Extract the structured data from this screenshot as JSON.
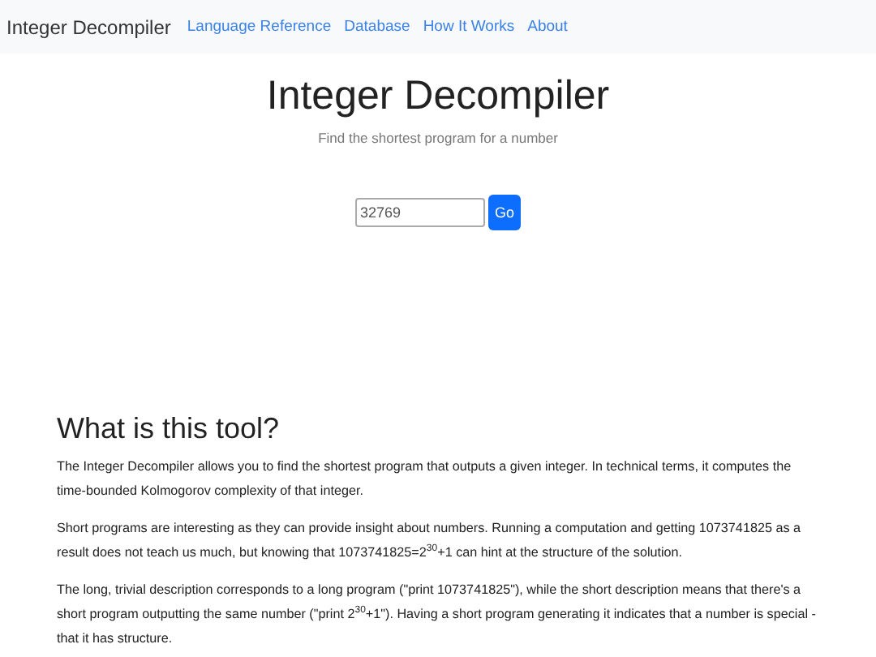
{
  "navbar": {
    "brand": "Integer Decompiler",
    "links": [
      "Language Reference",
      "Database",
      "How It Works",
      "About"
    ]
  },
  "header": {
    "title": "Integer Decompiler",
    "subtitle": "Find the shortest program for a number"
  },
  "search": {
    "value": "32769",
    "button": "Go"
  },
  "about": {
    "heading": "What is this tool?",
    "paragraphs": [
      "The Integer Decompiler allows you to find the shortest program that outputs a given integer. In technical terms, it computes the time-bounded Kolmogorov complexity of that integer.",
      "Short programs are interesting as they can provide insight about numbers. Running a computation and getting 1073741825 as a result does not teach us much, but knowing that 1073741825=2$^{30}$+1 can hint at the structure of the solution.",
      "The long, trivial description corresponds to a long program (\"print 1073741825\"), while the short description means that there's a short program outputting the same number (\"print 2$^{30}$+1\"). Having a short program generating it indicates that a number is special - that it has structure."
    ]
  }
}
